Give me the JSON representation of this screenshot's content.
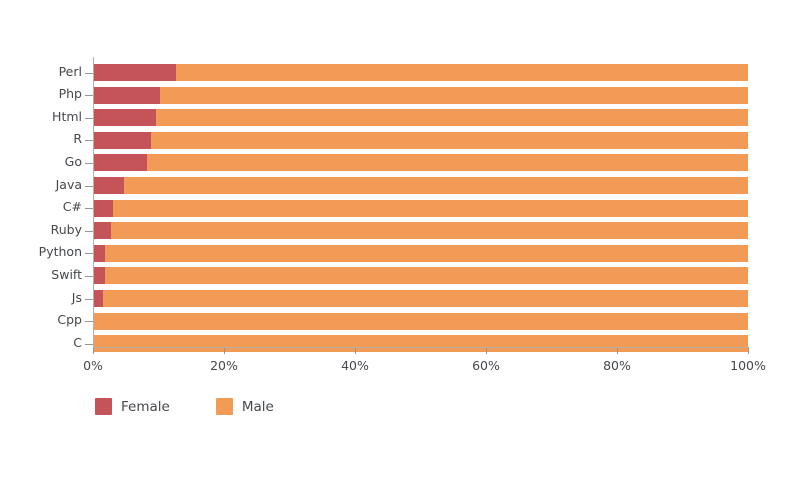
{
  "chart_data": {
    "type": "bar",
    "orientation": "horizontal",
    "stacked": true,
    "normalized": true,
    "title": "",
    "subtitle": "",
    "xlabel": "",
    "ylabel": "",
    "xlim": [
      0,
      100
    ],
    "xticks": [
      0,
      20,
      40,
      60,
      80,
      100
    ],
    "xtick_labels": [
      "0%",
      "20%",
      "40%",
      "60%",
      "80%",
      "100%"
    ],
    "grid": false,
    "legend_position": "bottom-left",
    "categories": [
      "Perl",
      "Php",
      "Html",
      "R",
      "Go",
      "Java",
      "C#",
      "Ruby",
      "Python",
      "Swift",
      "Js",
      "Cpp",
      "C"
    ],
    "series": [
      {
        "name": "Female",
        "color": "#c4545a",
        "values": [
          12.7,
          10.3,
          9.6,
          8.8,
          8.2,
          4.8,
          3.1,
          2.8,
          1.9,
          1.9,
          1.5,
          0.0,
          0.0
        ]
      },
      {
        "name": "Male",
        "color": "#f29b57",
        "values": [
          87.3,
          89.7,
          90.4,
          91.2,
          91.8,
          95.2,
          96.9,
          97.2,
          98.1,
          98.1,
          98.5,
          100.0,
          100.0
        ]
      }
    ]
  },
  "legend": {
    "items": [
      {
        "label": "Female",
        "color": "#c4545a"
      },
      {
        "label": "Male",
        "color": "#f29b57"
      }
    ]
  },
  "axis": {
    "x_tick_labels": [
      "0%",
      "20%",
      "40%",
      "60%",
      "80%",
      "100%"
    ],
    "y_tick_labels": [
      "Perl",
      "Php",
      "Html",
      "R",
      "Go",
      "Java",
      "C#",
      "Ruby",
      "Python",
      "Swift",
      "Js",
      "Cpp",
      "C"
    ]
  },
  "colors": {
    "female": "#c4545a",
    "male": "#f29b57",
    "axis": "#b5b0a6",
    "tick_text": "#45484c",
    "background": "#ffffff"
  }
}
